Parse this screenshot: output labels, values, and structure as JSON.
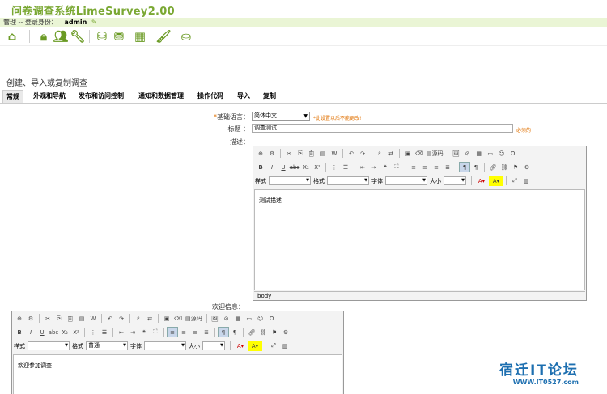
{
  "app_title": "问卷调查系统LimeSurvey2.00",
  "admin": {
    "manage_label": "管理",
    "login_as": "-- 登录身份：",
    "username": "admin"
  },
  "icons": [
    "home-icon",
    "lock-icon",
    "users-icon",
    "wrench-icon",
    "check-db-icon",
    "db-icon",
    "grid-icon",
    "brush-icon",
    "db-arrow-icon"
  ],
  "page_heading": "创建、导入或复制调查",
  "tabs": [
    "常规",
    "外观和导航",
    "发布和访问控制",
    "通知和数据管理",
    "操作代码",
    "导入",
    "复制"
  ],
  "form": {
    "base_lang_label": "基础语言：",
    "base_lang_value": "简体中文",
    "base_lang_hint": "*此设置以后不能更改!",
    "title_label": "标题 ：",
    "title_value": "调查测试",
    "title_hint": "必须的",
    "desc_label": "描述：",
    "desc_value": "测试描述",
    "desc_status": "body",
    "welcome_label": "欢迎信息：",
    "welcome_value": "欢迎参加调查"
  },
  "toolbar": {
    "source_label": "源码",
    "style_label": "样式",
    "format_label": "格式",
    "font_label": "字体",
    "size_label": "大小",
    "format_value_2": "普通"
  },
  "watermark": {
    "line1": "宿迁IT论坛",
    "line2": "WWW.IT0527.com"
  }
}
